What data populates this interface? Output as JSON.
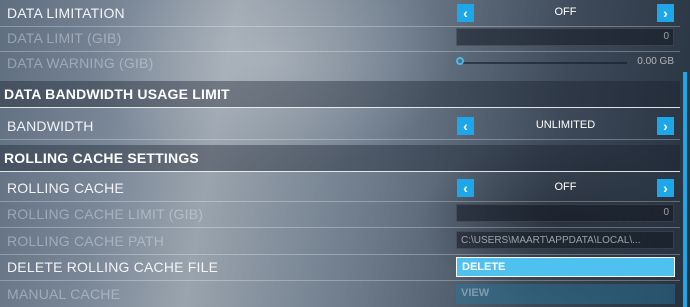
{
  "settings": {
    "data_limitation": {
      "label": "DATA LIMITATION",
      "value": "OFF"
    },
    "data_limit": {
      "label": "DATA LIMIT (GIB)",
      "value": "0"
    },
    "data_warning": {
      "label": "DATA WARNING (GIB)",
      "value": "0.00 GB",
      "level": 0
    },
    "section_bandwidth": "DATA BANDWIDTH USAGE LIMIT",
    "bandwidth": {
      "label": "BANDWIDTH",
      "value": "UNLIMITED"
    },
    "section_rolling": "ROLLING CACHE SETTINGS",
    "rolling_cache": {
      "label": "ROLLING CACHE",
      "value": "OFF"
    },
    "rolling_cache_limit": {
      "label": "ROLLING CACHE LIMIT (GIB)",
      "value": "0"
    },
    "rolling_cache_path": {
      "label": "ROLLING CACHE PATH",
      "value": "C:\\USERS\\MAART\\APPDATA\\LOCAL\\..."
    },
    "delete_rolling_cache": {
      "label": "DELETE ROLLING CACHE FILE",
      "button": "DELETE"
    },
    "manual_cache": {
      "label": "MANUAL CACHE",
      "button": "VIEW"
    }
  },
  "icons": {
    "left": "chevron-left-icon",
    "right": "chevron-right-icon"
  },
  "colors": {
    "accent": "#1ea7e8",
    "button": "#4fc1ef"
  }
}
